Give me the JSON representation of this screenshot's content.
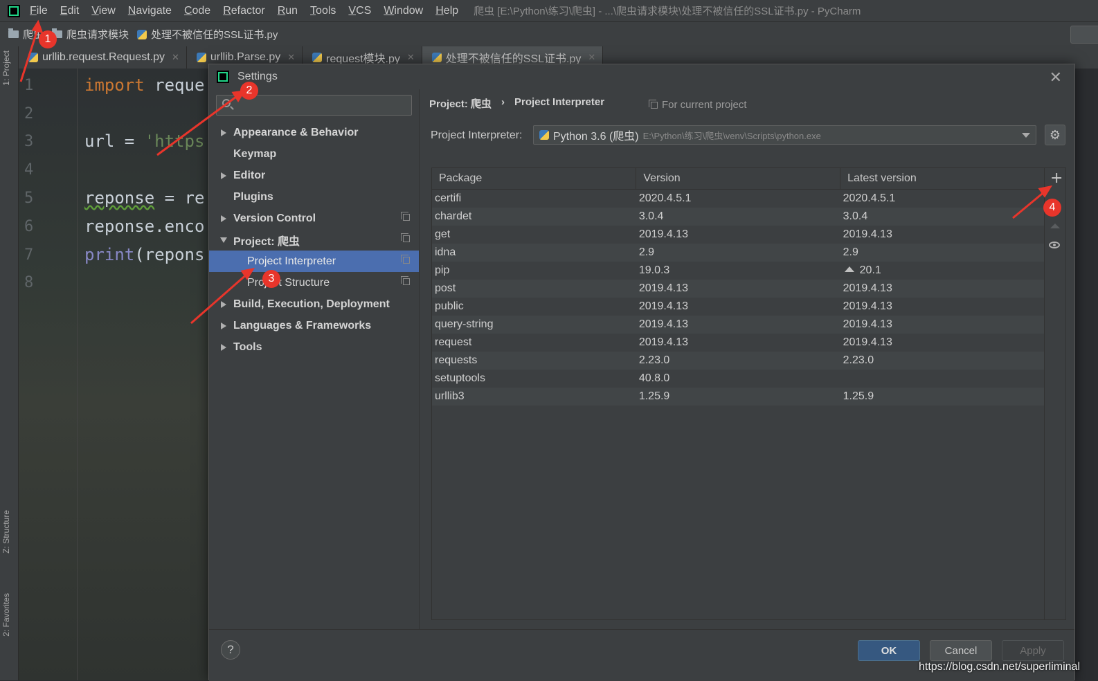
{
  "menubar": {
    "items": [
      "File",
      "Edit",
      "View",
      "Navigate",
      "Code",
      "Refactor",
      "Run",
      "Tools",
      "VCS",
      "Window",
      "Help"
    ],
    "window_title": "爬虫 [E:\\Python\\练习\\爬虫] - ...\\爬虫请求模块\\处理不被信任的SSL证书.py - PyCharm"
  },
  "navbar": {
    "crumbs": [
      "爬虫",
      "爬虫请求模块",
      "处理不被信任的SSL证书.py"
    ]
  },
  "left_stripe": {
    "project_tab": "1: Project",
    "structure_tab": "Z: Structure",
    "favorites_tab": "2: Favorites"
  },
  "editor_tabs": [
    "urllib.request.Request.py",
    "urllib.Parse.py",
    "request模块.py",
    "处理不被信任的SSL证书.py"
  ],
  "editor": {
    "line_numbers": [
      "1",
      "2",
      "3",
      "4",
      "5",
      "6",
      "7",
      "8"
    ],
    "lines": [
      {
        "kw": "import",
        "rest": " reque"
      },
      {
        "kw": "",
        "rest": ""
      },
      {
        "kw": "",
        "rest": "url = ",
        "str": "'https"
      },
      {
        "kw": "",
        "rest": ""
      },
      {
        "kw": "",
        "rest": " = re",
        "wavy": "reponse"
      },
      {
        "kw": "",
        "rest": "reponse.enco"
      },
      {
        "kw": "",
        "fn": "print",
        "rest": "(repons"
      },
      {
        "kw": "",
        "rest": ""
      }
    ]
  },
  "dialog": {
    "title": "Settings",
    "tree": [
      {
        "label": "Appearance & Behavior",
        "arrow": "right"
      },
      {
        "label": "Keymap",
        "arrow": "none"
      },
      {
        "label": "Editor",
        "arrow": "right"
      },
      {
        "label": "Plugins",
        "arrow": "none"
      },
      {
        "label": "Version Control",
        "arrow": "right"
      },
      {
        "label": "Project: 爬虫",
        "arrow": "down"
      },
      {
        "label": "Project Interpreter",
        "arrow": "sub",
        "selected": true
      },
      {
        "label": "Project Structure",
        "arrow": "sub"
      },
      {
        "label": "Build, Execution, Deployment",
        "arrow": "right"
      },
      {
        "label": "Languages & Frameworks",
        "arrow": "right"
      },
      {
        "label": "Tools",
        "arrow": "right"
      }
    ],
    "breadcrumb": [
      "Project: 爬虫",
      "›",
      "Project Interpreter"
    ],
    "for_current_project": "For current project",
    "interpreter_label": "Project Interpreter:",
    "interpreter_name": "Python 3.6 (爬虫)",
    "interpreter_path": "E:\\Python\\练习\\爬虫\\venv\\Scripts\\python.exe",
    "table": {
      "headers": [
        "Package",
        "Version",
        "Latest version"
      ],
      "rows": [
        [
          "certifi",
          "2020.4.5.1",
          "2020.4.5.1"
        ],
        [
          "chardet",
          "3.0.4",
          "3.0.4"
        ],
        [
          "get",
          "2019.4.13",
          "2019.4.13"
        ],
        [
          "idna",
          "2.9",
          "2.9"
        ],
        [
          "pip",
          "19.0.3",
          "20.1"
        ],
        [
          "post",
          "2019.4.13",
          "2019.4.13"
        ],
        [
          "public",
          "2019.4.13",
          "2019.4.13"
        ],
        [
          "query-string",
          "2019.4.13",
          "2019.4.13"
        ],
        [
          "request",
          "2019.4.13",
          "2019.4.13"
        ],
        [
          "requests",
          "2.23.0",
          "2.23.0"
        ],
        [
          "setuptools",
          "40.8.0",
          ""
        ],
        [
          "urllib3",
          "1.25.9",
          "1.25.9"
        ]
      ],
      "upgrade_row": 4
    },
    "buttons": {
      "help": "?",
      "ok": "OK",
      "cancel": "Cancel",
      "apply": "Apply"
    }
  },
  "annotations": [
    "1",
    "2",
    "3",
    "4"
  ],
  "watermark": "https://blog.csdn.net/superliminal"
}
